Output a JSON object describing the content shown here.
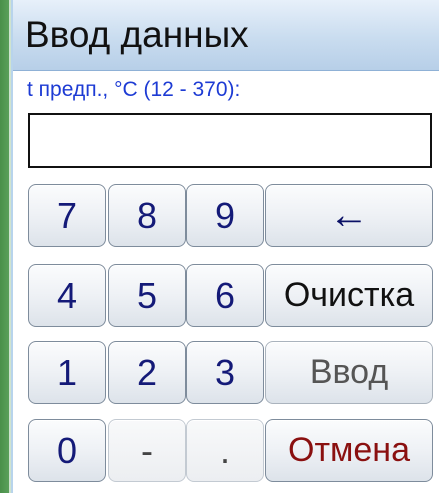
{
  "dialog": {
    "title": "Ввод данных",
    "prompt": "t предп., °C (12 - 370):",
    "input_value": ""
  },
  "keypad": {
    "k7": "7",
    "k8": "8",
    "k9": "9",
    "k4": "4",
    "k5": "5",
    "k6": "6",
    "k1": "1",
    "k2": "2",
    "k3": "3",
    "k0": "0",
    "minus": "-",
    "dot": ".",
    "backspace": "←",
    "clear": "Очистка",
    "enter": "Ввод",
    "cancel": "Отмена"
  },
  "colors": {
    "prompt": "#1d3bd4",
    "digit": "#141a78",
    "cancel": "#8a1010",
    "enter_disabled": "#555555"
  }
}
